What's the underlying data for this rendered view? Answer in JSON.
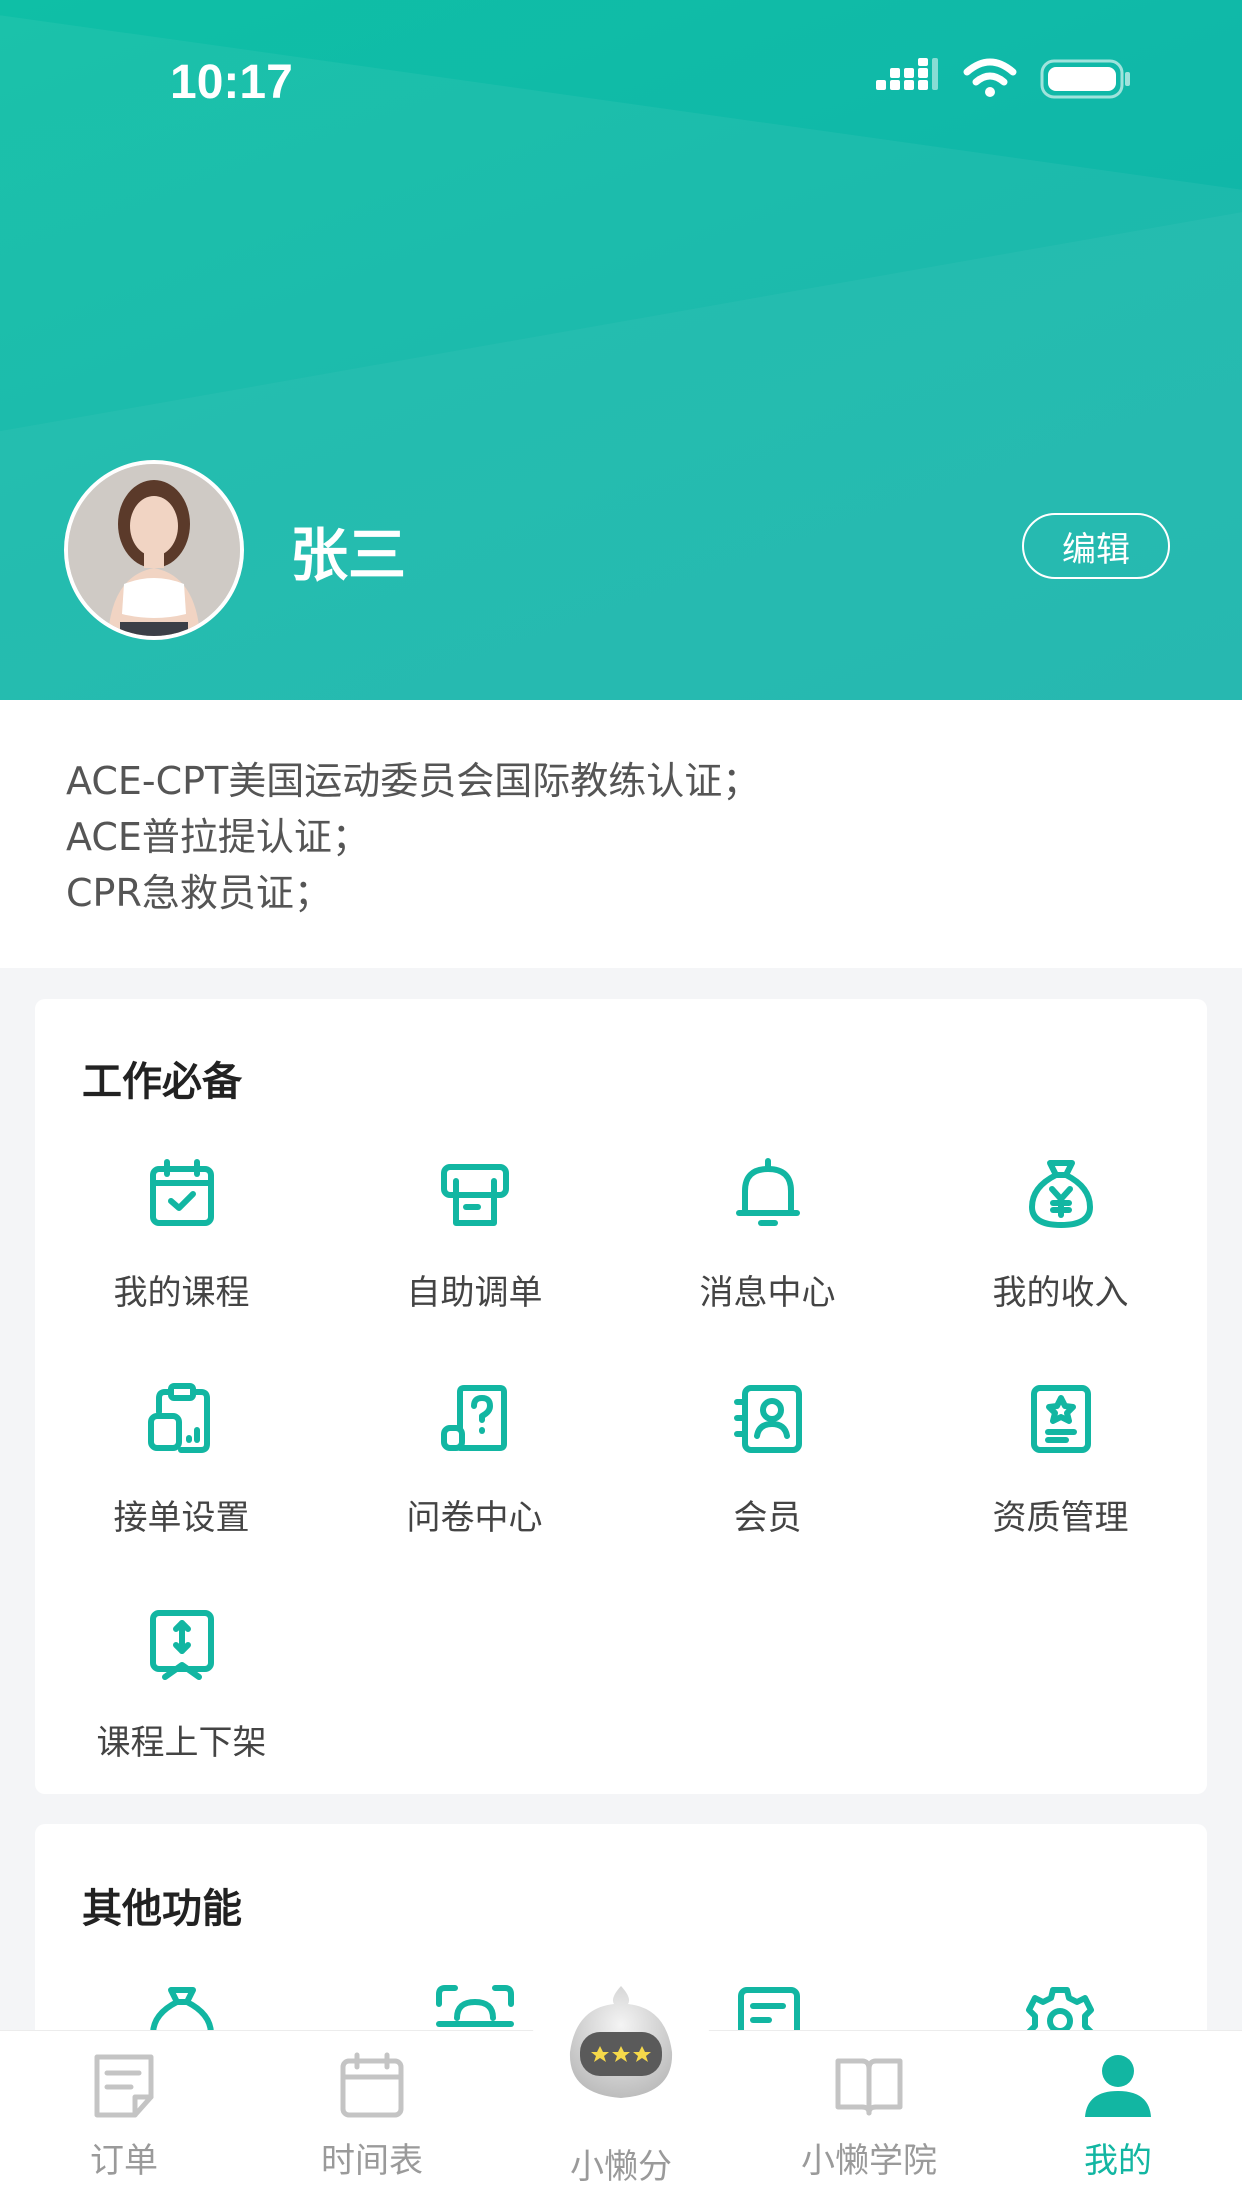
{
  "status_bar": {
    "time": "10:17"
  },
  "profile": {
    "name": "张三",
    "edit_label": "编辑"
  },
  "certificates": [
    "ACE-CPT美国运动委员会国际教练认证；",
    "ACE普拉提认证；",
    "CPR急救员证；"
  ],
  "work_section": {
    "title": "工作必备",
    "items": [
      {
        "label": "我的课程",
        "icon": "calendar-check-icon"
      },
      {
        "label": "自助调单",
        "icon": "printer-doc-icon"
      },
      {
        "label": "消息中心",
        "icon": "bell-icon"
      },
      {
        "label": "我的收入",
        "icon": "money-bag-icon"
      },
      {
        "label": "接单设置",
        "icon": "clipboard-settings-icon"
      },
      {
        "label": "问卷中心",
        "icon": "question-doc-icon"
      },
      {
        "label": "会员",
        "icon": "member-card-icon"
      },
      {
        "label": "资质管理",
        "icon": "certificate-icon"
      },
      {
        "label": "课程上下架",
        "icon": "shelf-updown-icon"
      }
    ]
  },
  "other_section": {
    "title": "其他功能"
  },
  "tabbar": {
    "items": [
      {
        "label": "订单",
        "icon": "order-icon"
      },
      {
        "label": "时间表",
        "icon": "schedule-icon"
      },
      {
        "label": "小懒分",
        "icon": "robot-icon"
      },
      {
        "label": "小懒学院",
        "icon": "book-icon"
      },
      {
        "label": "我的",
        "icon": "person-icon"
      }
    ],
    "active": "我的"
  },
  "colors": {
    "accent": "#12b6a2",
    "header_gradient_start": "#0fbfa6",
    "header_gradient_end": "#13b3a9"
  }
}
